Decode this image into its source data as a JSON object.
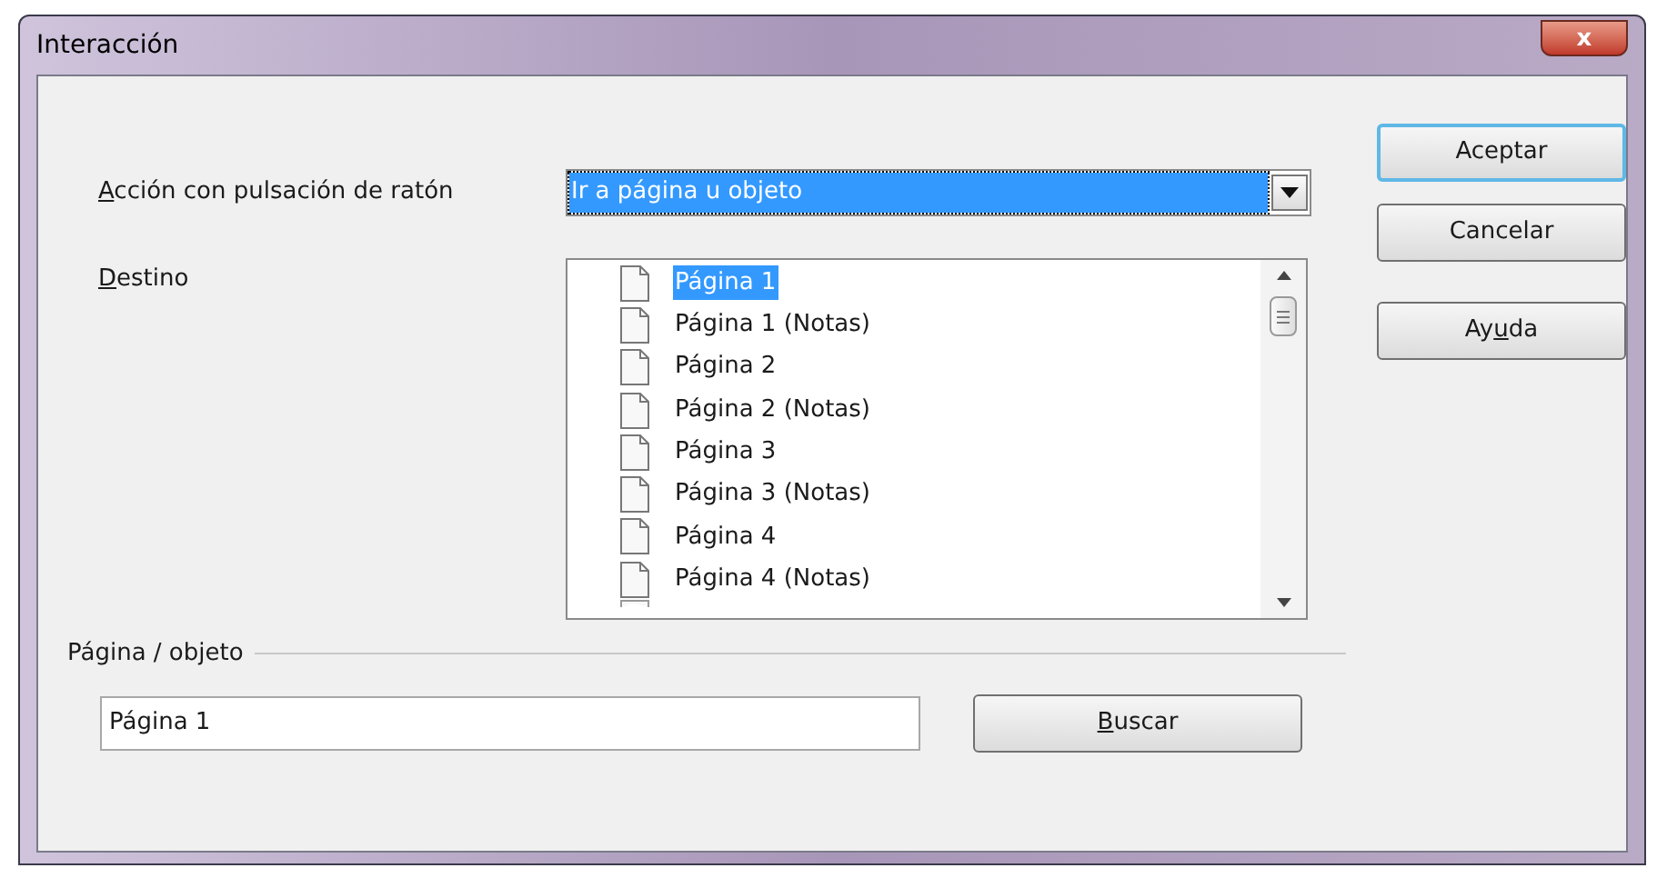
{
  "window": {
    "title": "Interacción",
    "close": "x"
  },
  "action": {
    "label": [
      {
        "text": "A",
        "underlined": true
      },
      {
        "text": "cción con pulsación de ratón",
        "underlined": false
      }
    ],
    "value": "Ir a página u objeto",
    "focused": true
  },
  "destination": {
    "label": [
      {
        "text": "D",
        "underlined": true
      },
      {
        "text": "estino",
        "underlined": false
      }
    ],
    "items": [
      {
        "label": "Página 1",
        "selected": true
      },
      {
        "label": "Página 1 (Notas)",
        "selected": false
      },
      {
        "label": "Página 2",
        "selected": false
      },
      {
        "label": "Página 2 (Notas)",
        "selected": false
      },
      {
        "label": "Página 3",
        "selected": false
      },
      {
        "label": "Página 3 (Notas)",
        "selected": false
      },
      {
        "label": "Página 4",
        "selected": false
      },
      {
        "label": "Página 4 (Notas)",
        "selected": false
      }
    ]
  },
  "page_object": {
    "legend": "Página / objeto",
    "value": "Página 1",
    "button": {
      "label": [
        {
          "text": "B",
          "underlined": true
        },
        {
          "text": "uscar",
          "underlined": false
        }
      ]
    }
  },
  "buttons": [
    {
      "label": [
        {
          "text": "Aceptar",
          "underlined": false
        }
      ],
      "default": true
    },
    {
      "label": [
        {
          "text": "Cancelar",
          "underlined": false
        }
      ],
      "default": false
    },
    {
      "label": [
        {
          "text": "Ay",
          "underlined": false
        },
        {
          "text": "u",
          "underlined": true
        },
        {
          "text": "da",
          "underlined": false
        }
      ],
      "default": false
    }
  ]
}
